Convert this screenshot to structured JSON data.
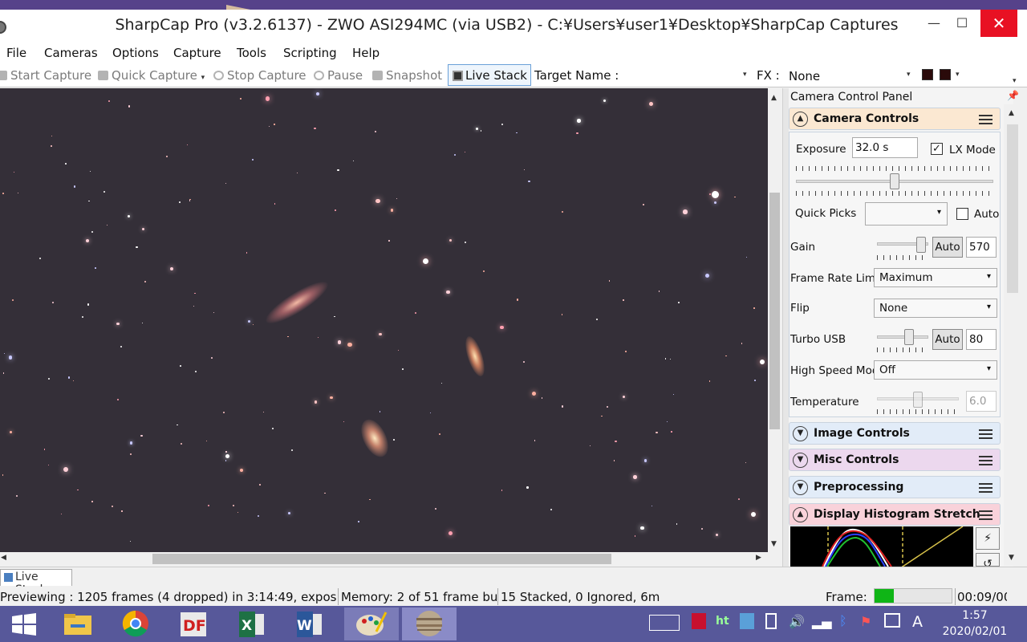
{
  "window": {
    "title": "SharpCap Pro (v3.2.6137) - ZWO ASI294MC (via USB2) - C:¥Users¥user1¥Desktop¥SharpCap Captures",
    "minimize": "—",
    "maximize": "☐",
    "close": "✕"
  },
  "menu": [
    "File",
    "Cameras",
    "Options",
    "Capture",
    "Tools",
    "Scripting",
    "Help"
  ],
  "toolbar": {
    "start_capture": "Start Capture",
    "quick_capture": "Quick Capture",
    "stop_capture": "Stop Capture",
    "pause": "Pause",
    "snapshot": "Snapshot",
    "live_stack": "Live Stack",
    "target_name_label": "Target Name :",
    "target_name_value": "",
    "fx_label": "FX :",
    "fx_value": "None"
  },
  "panel": {
    "title": "Camera Control Panel",
    "camera_controls": {
      "label": "Camera Controls",
      "exposure_label": "Exposure",
      "exposure_value": "32.0 s",
      "lx_mode_label": "LX Mode",
      "lx_mode_checked": true,
      "exposure_slider_fraction": 0.5,
      "quick_picks_label": "Quick Picks",
      "quick_picks_value": "",
      "quick_picks_auto_label": "Auto",
      "gain_label": "Gain",
      "gain_auto": "Auto",
      "gain_value": "570",
      "gain_slider_fraction": 0.95,
      "frame_rate_label": "Frame Rate Limit",
      "frame_rate_value": "Maximum",
      "flip_label": "Flip",
      "flip_value": "None",
      "turbo_usb_label": "Turbo USB",
      "turbo_usb_auto": "Auto",
      "turbo_usb_value": "80",
      "turbo_usb_slider_fraction": 0.66,
      "high_speed_label": "High Speed Mode",
      "high_speed_value": "Off",
      "temperature_label": "Temperature",
      "temperature_value": "6.0",
      "temperature_slider_fraction": 0.5
    },
    "image_controls": "Image Controls",
    "misc_controls": "Misc Controls",
    "preprocessing": "Preprocessing",
    "display_histogram_stretch": "Display Histogram Stretch",
    "section_colors": {
      "camera": "#fbe8d2",
      "image": "#e2ecf8",
      "misc": "#ecd8ee",
      "pre": "#e2ecf8",
      "hist": "#f9d2da"
    }
  },
  "tabs": {
    "live_stack": "Live Stack"
  },
  "status": {
    "previewing": "Previewing : 1205 frames (4 dropped) in 3:14:49, exposur",
    "memory": "Memory: 2 of 51 frame buf",
    "stacked": "15 Stacked, 0 Ignored, 6m",
    "frame_label": "Frame:",
    "frame_progress_fraction": 0.25,
    "elapsed": "00:09/00"
  },
  "taskbar": {
    "apps": [
      "windows-start",
      "file-explorer",
      "chrome",
      "deep-freeze",
      "excel",
      "word",
      "paint",
      "sharpcap"
    ],
    "time": "1:57",
    "date": "2020/02/01",
    "ime": "A"
  }
}
